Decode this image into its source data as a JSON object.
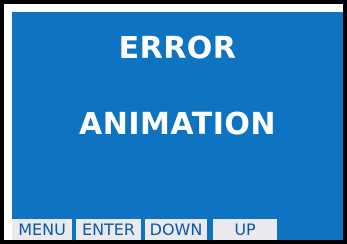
{
  "display": {
    "line1": "ERROR",
    "line2": "ANIMATION"
  },
  "softkeys": {
    "menu": "MENU",
    "enter": "ENTER",
    "down": "DOWN",
    "up": "UP"
  },
  "colors": {
    "screen_background": "#0e74c1",
    "text": "#ffffff",
    "softkey_background": "#e9e9ee",
    "softkey_text": "#0b58a8",
    "frame": "#000000"
  }
}
